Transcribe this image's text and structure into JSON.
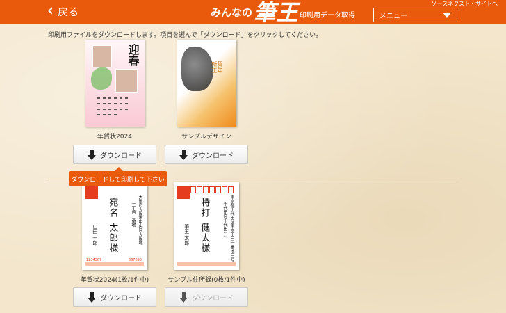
{
  "header": {
    "back_label": "戻る",
    "brand_pre": "みんなの",
    "brand_main": "筆王",
    "brand_sub": "印刷用データ取得",
    "external_link": "ソースネクスト・サイトへ",
    "menu_label": "メニュー",
    "accent_color": "#ea5a0d"
  },
  "instruction": "印刷用ファイルをダウンロードします。項目を選んで「ダウンロード」をクリックしてください。",
  "cards": [
    {
      "label": "年賀状2024",
      "button": "ダウンロード",
      "thumb_text": "迎春"
    },
    {
      "label": "サンプルデザイン",
      "button": "ダウンロード",
      "thumb_text": "新賀\n正年"
    },
    {
      "label": "年賀状2024(1枚/1件中)",
      "button": "ダウンロード",
      "addr_lines": [
        "大阪府大阪市中央区大阪城",
        "一丁目一番地"
      ],
      "name": "宛名 太郎様",
      "sender": "山田 一郎"
    },
    {
      "label": "サンプル住所録(0枚/1件中)",
      "button": "ダウンロード",
      "button_disabled": true,
      "addr_lines": [
        "東京都千代田区東京丁目一番地三号",
        "千代田区千代田1-1"
      ],
      "name": "特打 健太様",
      "sender": "筆王 太郎"
    }
  ],
  "tooltip": "ダウンロードして印刷して下さい",
  "postal_code": "1234567",
  "footer_zip": "567890"
}
